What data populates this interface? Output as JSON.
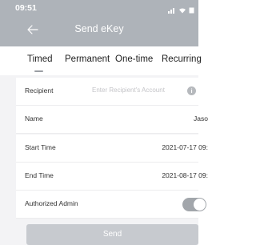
{
  "status_bar": {
    "time": "09:51"
  },
  "header": {
    "title": "Send eKey"
  },
  "tabs": [
    {
      "label": "Timed",
      "selected": true
    },
    {
      "label": "Permanent",
      "selected": false
    },
    {
      "label": "One-time",
      "selected": false
    },
    {
      "label": "Recurring",
      "selected": false
    }
  ],
  "form": {
    "recipient": {
      "label": "Recipient",
      "placeholder": "Enter Recipient's Account"
    },
    "name": {
      "label": "Name",
      "value": "Jaso"
    },
    "start_time": {
      "label": "Start Time",
      "value": "2021-07-17 09:"
    },
    "end_time": {
      "label": "End Time",
      "value": "2021-08-17 09:"
    },
    "authorized_admin": {
      "label": "Authorized Admin",
      "enabled": true
    }
  },
  "send_button": {
    "label": "Send"
  },
  "colors": {
    "header": "#aeb3b9",
    "toggle_on": "#a2a6ab",
    "button": "#c7cacf"
  }
}
